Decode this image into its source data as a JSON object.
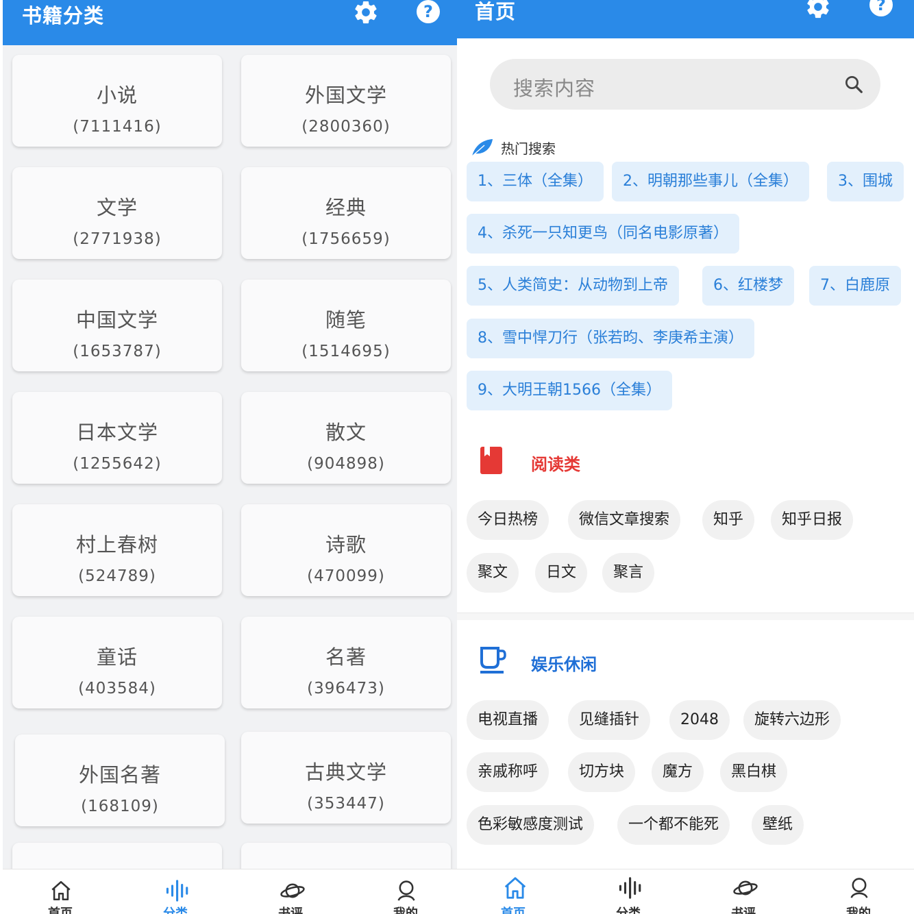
{
  "colors": {
    "primary": "#2a8ae8",
    "reading_accent": "#e53935",
    "leisure_accent": "#1f6fd6"
  },
  "left": {
    "title": "书籍分类",
    "categories": [
      {
        "name": "小说",
        "count": "(7111416)"
      },
      {
        "name": "外国文学",
        "count": "(2800360)"
      },
      {
        "name": "文学",
        "count": "(2771938)"
      },
      {
        "name": "经典",
        "count": "(1756659)"
      },
      {
        "name": "中国文学",
        "count": "(1653787)"
      },
      {
        "name": "随笔",
        "count": "(1514695)"
      },
      {
        "name": "日本文学",
        "count": "(1255642)"
      },
      {
        "name": "散文",
        "count": "(904898)"
      },
      {
        "name": "村上春树",
        "count": "(524789)"
      },
      {
        "name": "诗歌",
        "count": "(470099)"
      },
      {
        "name": "童话",
        "count": "(403584)"
      },
      {
        "name": "名著",
        "count": "(396473)"
      },
      {
        "name": "外国名著",
        "count": "(168109)"
      },
      {
        "name": "古典文学",
        "count": "(353447)"
      }
    ],
    "nav": [
      {
        "label": "首页",
        "icon": "home-icon"
      },
      {
        "label": "分类",
        "icon": "category-icon"
      },
      {
        "label": "书评",
        "icon": "planet-icon"
      },
      {
        "label": "我的",
        "icon": "user-icon"
      }
    ]
  },
  "right": {
    "title": "首页",
    "search_placeholder": "搜索内容",
    "hot_title": "热门搜索",
    "hot_items": [
      "1、三体（全集）",
      "2、明朝那些事儿（全集）",
      "3、围城",
      "4、杀死一只知更鸟（同名电影原著）",
      "5、人类简史：从动物到上帝",
      "6、红楼梦",
      "7、白鹿原",
      "8、雪中悍刀行（张若昀、李庚希主演）",
      "9、大明王朝1566（全集）"
    ],
    "reading": {
      "title": "阅读类",
      "tags": [
        "今日热榜",
        "微信文章搜索",
        "知乎",
        "知乎日报",
        "聚文",
        "日文",
        "聚言"
      ]
    },
    "leisure": {
      "title": "娱乐休闲",
      "tags": [
        "电视直播",
        "见缝插针",
        "2048",
        "旋转六边形",
        "亲戚称呼",
        "切方块",
        "魔方",
        "黑白棋",
        "色彩敏感度测试",
        "一个都不能死",
        "壁纸"
      ]
    },
    "nav": [
      {
        "label": "首页",
        "icon": "home-icon"
      },
      {
        "label": "分类",
        "icon": "category-icon"
      },
      {
        "label": "书评",
        "icon": "planet-icon"
      },
      {
        "label": "我的",
        "icon": "user-icon"
      }
    ]
  }
}
